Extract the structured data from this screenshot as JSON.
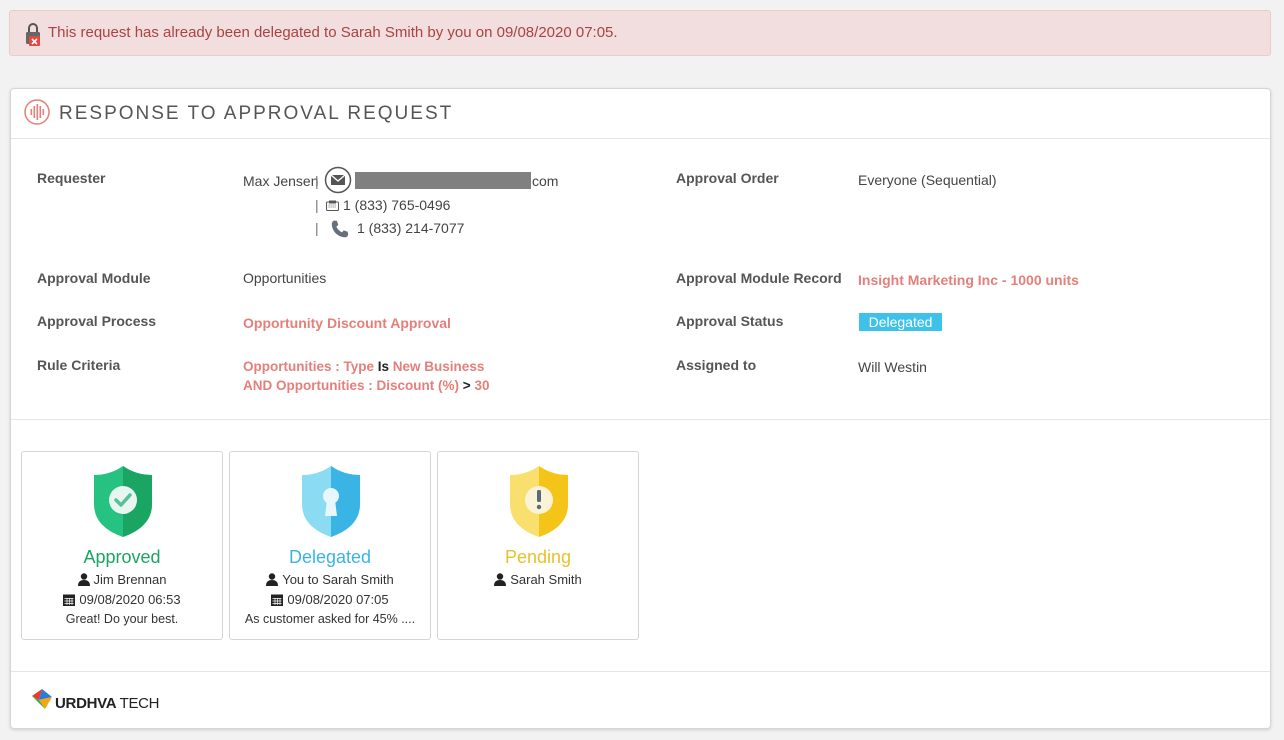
{
  "alert": {
    "message": "This request has already been delegated to Sarah Smith by you on 09/08/2020 07:05.",
    "icon": "lock-error-icon"
  },
  "header": {
    "title": "RESPONSE TO APPROVAL REQUEST",
    "icon": "soundwave-logo-icon"
  },
  "fields": {
    "requester_label": "Requester",
    "requester_name": "Max Jensen",
    "requester_email_suffix": "com",
    "requester_fax": "1 (833) 765-0496",
    "requester_phone": "1 (833) 214-7077",
    "approval_module_label": "Approval Module",
    "approval_module": "Opportunities",
    "approval_process_label": "Approval Process",
    "approval_process": "Opportunity Discount Approval",
    "rule_criteria_label": "Rule Criteria",
    "rule": {
      "line1_field": "Opportunities : Type",
      "line1_op": "Is",
      "line1_value": "New Business",
      "line2_conj": "AND",
      "line2_field": "Opportunities : Discount (%)",
      "line2_op": ">",
      "line2_value": "30"
    },
    "approval_order_label": "Approval Order",
    "approval_order": "Everyone (Sequential)",
    "approval_module_record_label": "Approval Module Record",
    "approval_module_record": "Insight Marketing Inc - 1000 units",
    "approval_status_label": "Approval Status",
    "approval_status": "Delegated",
    "assigned_to_label": "Assigned to",
    "assigned_to": "Will Westin"
  },
  "cards": [
    {
      "status": "Approved",
      "user": "Jim Brennan",
      "date": "09/08/2020 06:53",
      "comment": "Great! Do your best.",
      "color": "#1aa563",
      "icon": "check-shield-icon"
    },
    {
      "status": "Delegated",
      "user": "You to Sarah Smith",
      "date": "09/08/2020 07:05",
      "comment": "As customer asked for 45% ....",
      "color": "#3ab4e4",
      "icon": "keyhole-shield-icon"
    },
    {
      "status": "Pending",
      "user": "Sarah Smith",
      "color": "#e5c22b",
      "icon": "exclamation-shield-icon"
    }
  ],
  "footer": {
    "brand_bold": "URDHVA",
    "brand_light": "TECH"
  },
  "colors": {
    "link": "#e47f7a",
    "badge": "#3ec2ea",
    "alert_bg": "#f2dede",
    "alert_text": "#a94442"
  }
}
